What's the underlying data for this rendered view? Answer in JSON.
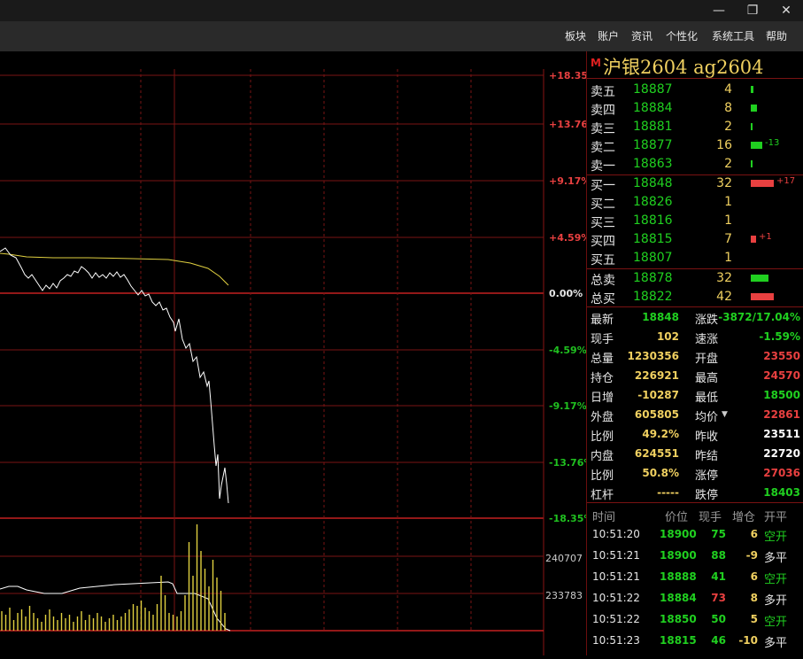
{
  "window": {
    "min_icon": "minimize-icon",
    "restore_icon": "restore-icon",
    "close_icon": "close-icon"
  },
  "menu": [
    "板块",
    "账户",
    "资讯",
    "个性化",
    "系统工具",
    "帮助"
  ],
  "chart": {
    "right_labels": [
      {
        "text": "+18.35%",
        "color": "#e84040"
      },
      {
        "text": "+13.76%",
        "color": "#e84040"
      },
      {
        "text": "+9.17%",
        "color": "#e84040"
      },
      {
        "text": "+4.59%",
        "color": "#e84040"
      },
      {
        "text": "0.00%",
        "color": "#e6e6e6"
      },
      {
        "text": "-4.59%",
        "color": "#20c020"
      },
      {
        "text": "-9.17%",
        "color": "#20c020"
      },
      {
        "text": "-13.76%",
        "color": "#20c020"
      },
      {
        "text": "-18.35%",
        "color": "#20c020"
      }
    ],
    "volume_labels": [
      "240707",
      "233783"
    ]
  },
  "quote": {
    "marker": "M",
    "title": "沪银2604  ag2604",
    "asks": [
      {
        "label": "卖五",
        "price": "18887",
        "vol": "4",
        "bar": 0.06,
        "delta": ""
      },
      {
        "label": "卖四",
        "price": "18884",
        "vol": "8",
        "bar": 0.12,
        "delta": ""
      },
      {
        "label": "卖三",
        "price": "18881",
        "vol": "2",
        "bar": 0.03,
        "delta": ""
      },
      {
        "label": "卖二",
        "price": "18877",
        "vol": "16",
        "bar": 0.24,
        "delta": "-13"
      },
      {
        "label": "卖一",
        "price": "18863",
        "vol": "2",
        "bar": 0.03,
        "delta": ""
      }
    ],
    "bids": [
      {
        "label": "买一",
        "price": "18848",
        "vol": "32",
        "bar": 0.48,
        "delta": "+17"
      },
      {
        "label": "买二",
        "price": "18826",
        "vol": "1",
        "bar": 0,
        "delta": ""
      },
      {
        "label": "买三",
        "price": "18816",
        "vol": "1",
        "bar": 0,
        "delta": ""
      },
      {
        "label": "买四",
        "price": "18815",
        "vol": "7",
        "bar": 0.1,
        "delta": "+1"
      },
      {
        "label": "买五",
        "price": "18807",
        "vol": "1",
        "bar": 0,
        "delta": ""
      }
    ],
    "totals": [
      {
        "label": "总卖",
        "price": "18878",
        "vol": "32",
        "bar": 0.36,
        "color": "#20d020"
      },
      {
        "label": "总买",
        "price": "18822",
        "vol": "42",
        "bar": 0.47,
        "color": "#e84040"
      }
    ],
    "stats": [
      {
        "l1": "最新",
        "v1": "18848",
        "c1": "#20d020",
        "l2": "涨跌",
        "v2": "-3872/17.04%",
        "c2": "#20d020"
      },
      {
        "l1": "现手",
        "v1": "102",
        "c1": "#f0d060",
        "l2": "速涨",
        "v2": "-1.59%",
        "c2": "#20d020"
      },
      {
        "l1": "总量",
        "v1": "1230356",
        "c1": "#f0d060",
        "l2": "开盘",
        "v2": "23550",
        "c2": "#e84040"
      },
      {
        "l1": "持仓",
        "v1": "226921",
        "c1": "#f0d060",
        "l2": "最高",
        "v2": "24570",
        "c2": "#e84040"
      },
      {
        "l1": "日增",
        "v1": "-10287",
        "c1": "#f0d060",
        "l2": "最低",
        "v2": "18500",
        "c2": "#20d020"
      },
      {
        "l1": "外盘",
        "v1": "605805",
        "c1": "#f0d060",
        "l2": "均价",
        "v2": "22861",
        "c2": "#e84040"
      },
      {
        "l1": "比例",
        "v1": "49.2%",
        "c1": "#f0d060",
        "l2": "昨收",
        "v2": "23511",
        "c2": "#ffffff"
      },
      {
        "l1": "内盘",
        "v1": "624551",
        "c1": "#f0d060",
        "l2": "昨结",
        "v2": "22720",
        "c2": "#ffffff"
      },
      {
        "l1": "比例",
        "v1": "50.8%",
        "c1": "#f0d060",
        "l2": "涨停",
        "v2": "27036",
        "c2": "#e84040"
      },
      {
        "l1": "杠杆",
        "v1": "-----",
        "c1": "#f0d060",
        "l2": "跌停",
        "v2": "18403",
        "c2": "#20d020"
      }
    ],
    "ticks_header": {
      "time": "时间",
      "price": "价位",
      "vol": "现手",
      "oi": "增仓",
      "type": "开平"
    },
    "ticks": [
      {
        "time": "10:51:20",
        "price": "18900",
        "vol": "75",
        "vc": "#20d020",
        "oi": "6",
        "type": "空开",
        "tc": "#20d020"
      },
      {
        "time": "10:51:21",
        "price": "18900",
        "vol": "88",
        "vc": "#20d020",
        "oi": "-9",
        "type": "多平",
        "tc": "#e6e6e6"
      },
      {
        "time": "10:51:21",
        "price": "18888",
        "vol": "41",
        "vc": "#20d020",
        "oi": "6",
        "type": "空开",
        "tc": "#20d020"
      },
      {
        "time": "10:51:22",
        "price": "18884",
        "vol": "73",
        "vc": "#e84040",
        "oi": "8",
        "type": "多开",
        "tc": "#e6e6e6"
      },
      {
        "time": "10:51:22",
        "price": "18850",
        "vol": "50",
        "vc": "#20d020",
        "oi": "5",
        "type": "空开",
        "tc": "#20d020"
      },
      {
        "time": "10:51:23",
        "price": "18815",
        "vol": "46",
        "vc": "#20d020",
        "oi": "-10",
        "type": "多平",
        "tc": "#e6e6e6"
      }
    ]
  }
}
